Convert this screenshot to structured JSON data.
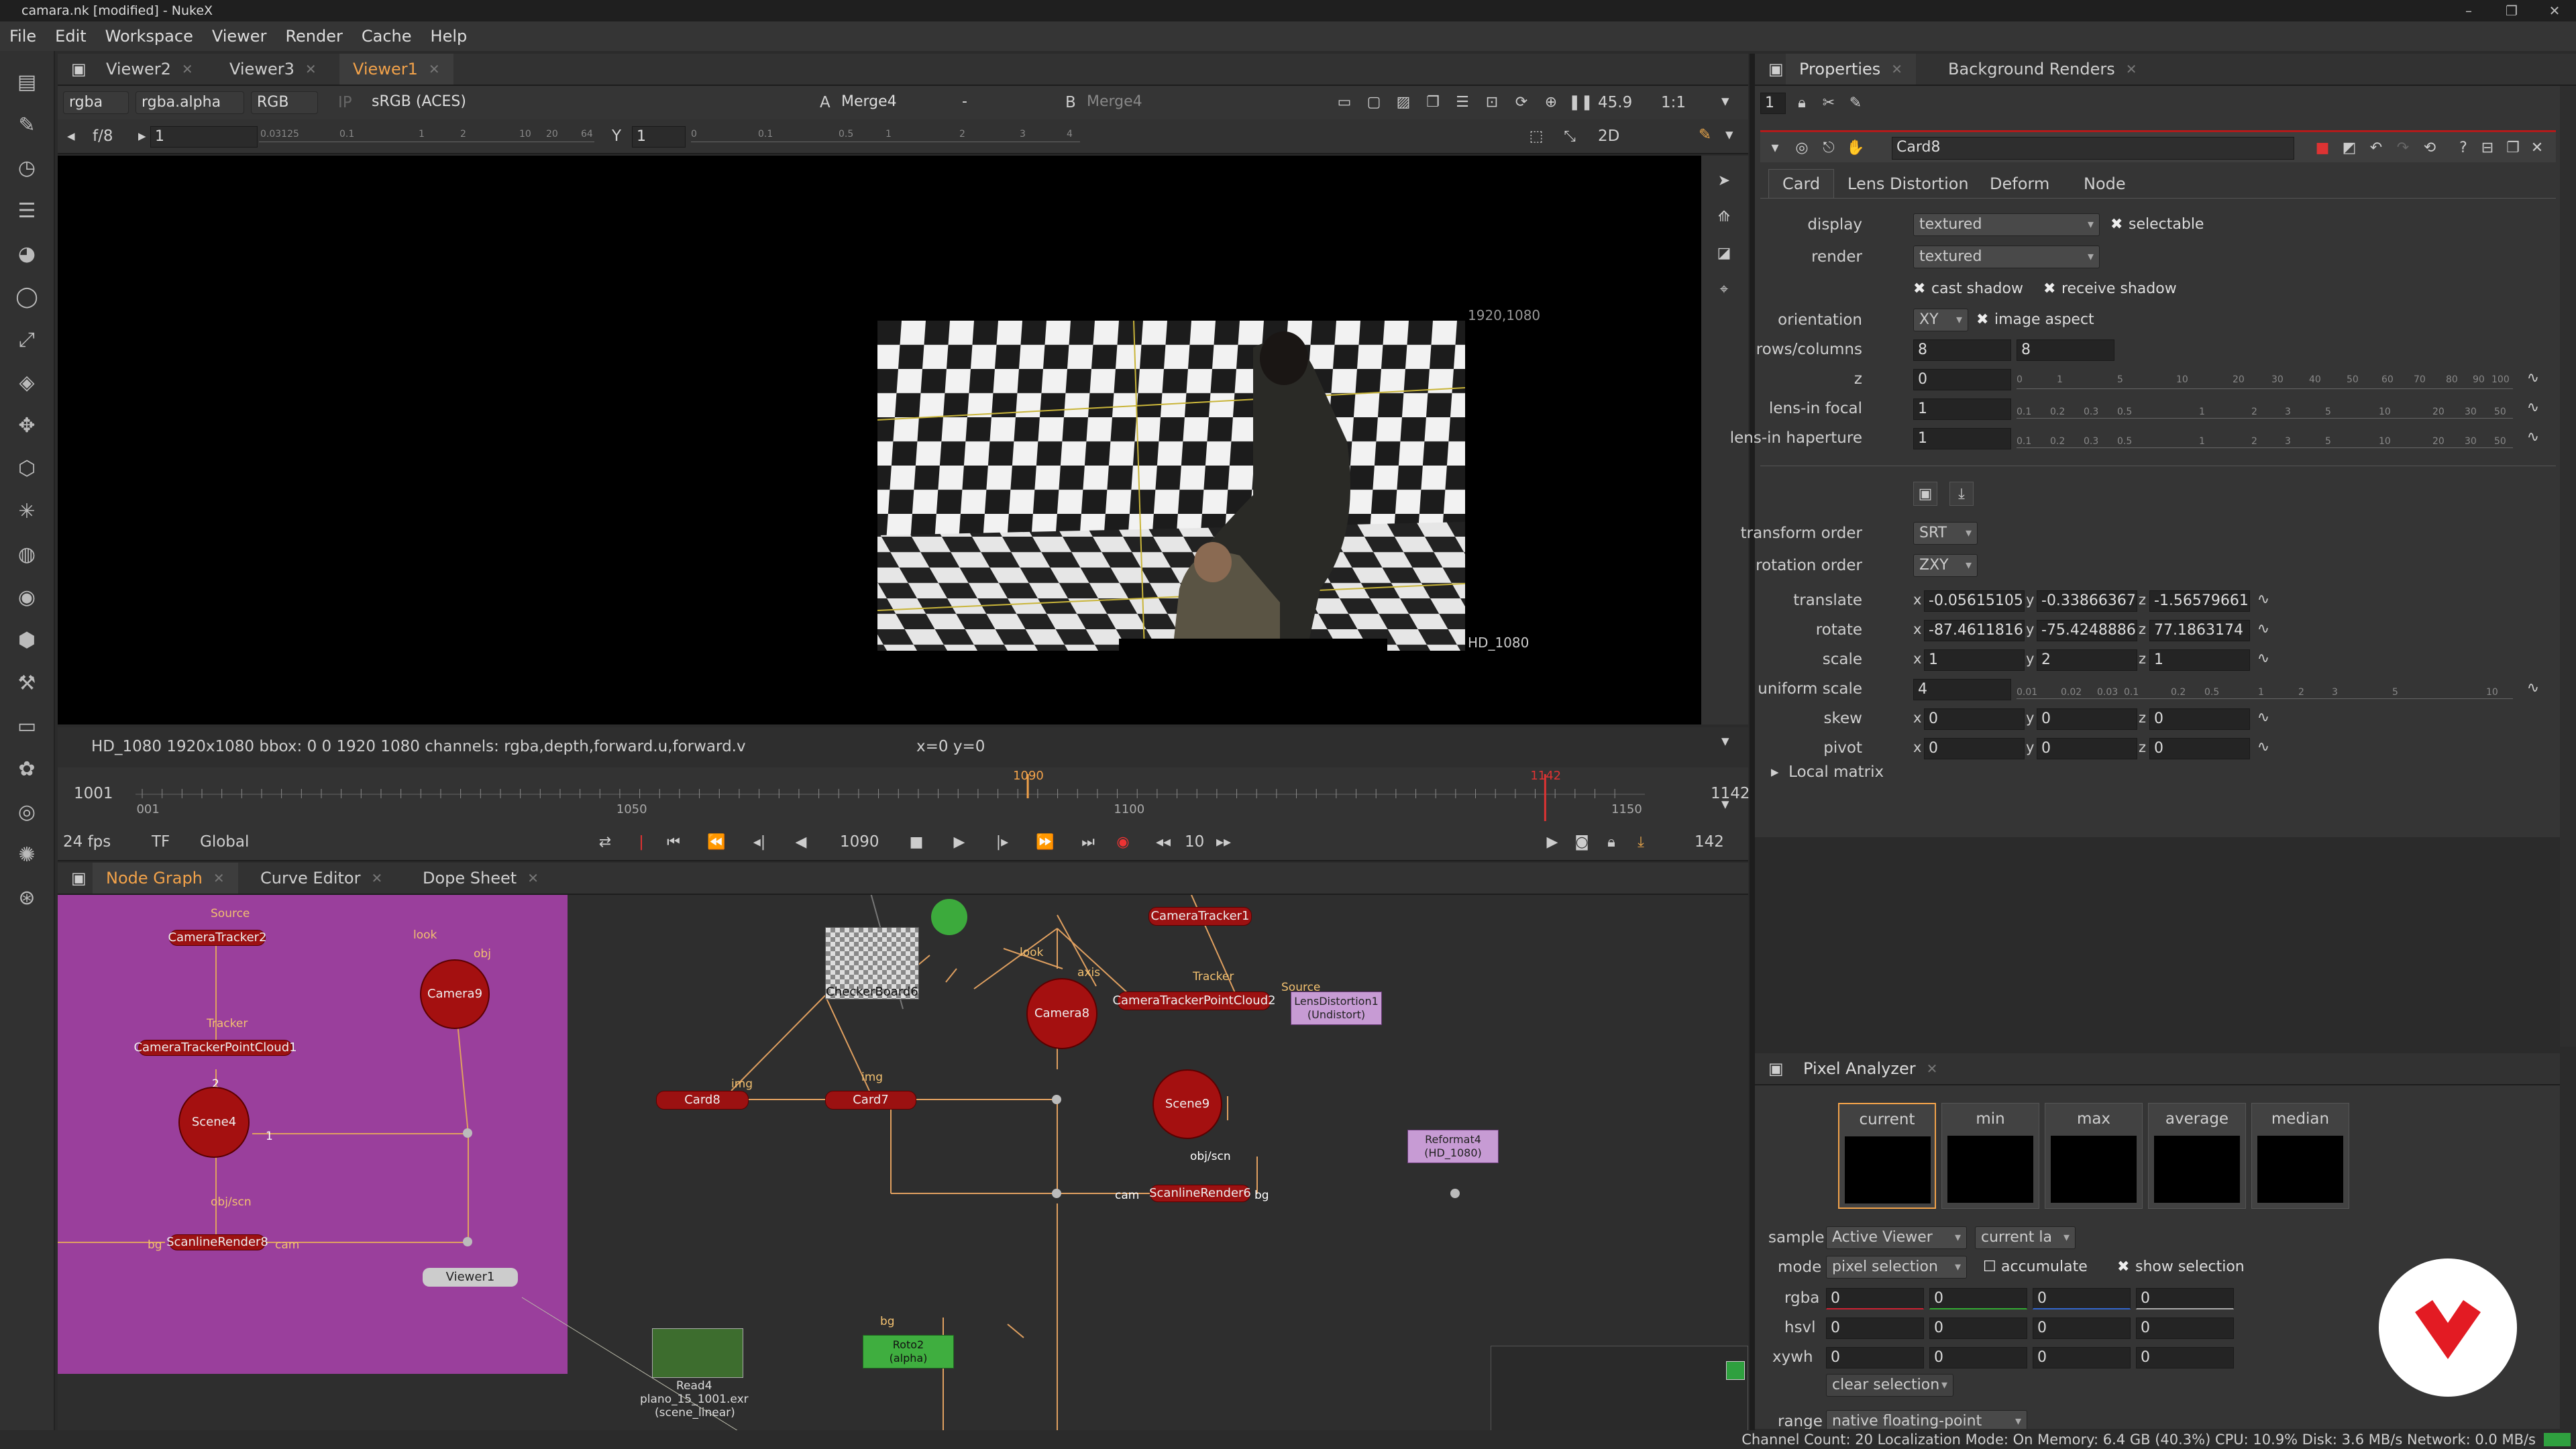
{
  "window": {
    "title": "camara.nk [modified] - NukeX",
    "min": "–",
    "max": "❐",
    "close": "✕"
  },
  "menu": [
    "File",
    "Edit",
    "Workspace",
    "Viewer",
    "Render",
    "Cache",
    "Help"
  ],
  "viewer": {
    "tabs": [
      "Viewer2",
      "Viewer3",
      "Viewer1"
    ],
    "channels": "rgba",
    "alpha": "rgba.alpha",
    "rgb": "RGB",
    "ip": "IP",
    "colorspace": "sRGB (ACES)",
    "a_label": "A",
    "a_input": "Merge4",
    "dash": "-",
    "b_label": "B",
    "b_input": "Merge4",
    "zoom": "45.9",
    "ratio": "1:1",
    "view_mode": "2D",
    "fstop": "f/8",
    "gain": "1",
    "y_label": "Y",
    "gamma": "1",
    "gain_ticks": [
      "0.03125",
      "0.1",
      "1",
      "2",
      "10",
      "20",
      "64"
    ],
    "gamma_ticks": [
      "0",
      "0.1",
      "0.5",
      "1",
      "2",
      "3",
      "4"
    ],
    "format_top": "1920,1080",
    "format_bottom": "HD_1080",
    "info_left": "HD_1080 1920x1080  bbox: 0 0 1920 1080 channels: rgba,depth,forward.u,forward.v",
    "info_coords": "x=0 y=0"
  },
  "timeline": {
    "start": "1001",
    "end": "1142",
    "current": "1090",
    "out_marker": "1142",
    "ticks": [
      "1001",
      "1050",
      "1100",
      "1150"
    ],
    "fps": "24 fps",
    "tf": "TF",
    "scope": "Global",
    "frame": "1090",
    "step": "10",
    "frames": "142"
  },
  "nodegraph": {
    "tabs": [
      "Node Graph",
      "Curve Editor",
      "Dope Sheet"
    ],
    "nodes": {
      "cameratracker2": "CameraTracker2",
      "pointcloud1": "CameraTrackerPointCloud1",
      "scene4": "Scene4",
      "scanline8": "ScanlineRender8",
      "camera9": "Camera9",
      "viewer1": "Viewer1",
      "checker6": "CheckerBoard6",
      "card8": "Card8",
      "card7": "Card7",
      "camera8": "Camera8",
      "cameratracker1": "CameraTracker1",
      "pointcloud2": "CameraTrackerPointCloud2",
      "lensdist": "LensDistortion1",
      "lensdist_sub": "(Undistort)",
      "scene9": "Scene9",
      "scanline6": "ScanlineRender6",
      "reformat4": "Reformat4",
      "reformat4_sub": "(HD_1080)",
      "read4": "Read4",
      "read4_sub": "plano_15_1001.exr",
      "read4_cs": "(scene_linear)",
      "roto2": "Roto2",
      "roto2_sub": "(alpha)"
    },
    "pins": {
      "source": "Source",
      "tracker": "Tracker",
      "look": "look",
      "obj": "obj",
      "img": "img",
      "axis": "axis",
      "objscn": "obj/scn",
      "bg": "bg",
      "cam": "cam",
      "n2": "2",
      "n1": "1"
    }
  },
  "properties": {
    "tabs": [
      "Properties",
      "Background Renders"
    ],
    "panel_count": "1",
    "node_name": "Card8",
    "subtabs": [
      "Card",
      "Lens Distortion",
      "Deform",
      "Node"
    ],
    "display": {
      "label": "display",
      "value": "textured",
      "selectable": "selectable"
    },
    "render": {
      "label": "render",
      "value": "textured"
    },
    "cast_shadow": "cast shadow",
    "receive_shadow": "receive shadow",
    "orientation": {
      "label": "orientation",
      "value": "XY",
      "image_aspect": "image aspect"
    },
    "rows_columns": {
      "label": "rows/columns",
      "rows": "8",
      "cols": "8"
    },
    "z": {
      "label": "z",
      "value": "0"
    },
    "lens_focal": {
      "label": "lens-in focal",
      "value": "1"
    },
    "lens_haperture": {
      "label": "lens-in haperture",
      "value": "1"
    },
    "slider_ticks_z": [
      "0",
      "1",
      "5",
      "10",
      "20",
      "30",
      "40",
      "50",
      "60",
      "70",
      "80",
      "90",
      "100"
    ],
    "slider_ticks_focal": [
      "0.1",
      "0.2",
      "0.3",
      "0.5",
      "1",
      "2",
      "3",
      "5",
      "10",
      "20",
      "30",
      "50"
    ],
    "transform_order": {
      "label": "transform order",
      "value": "SRT"
    },
    "rotation_order": {
      "label": "rotation order",
      "value": "ZXY"
    },
    "translate": {
      "label": "translate",
      "x": "-0.05615105",
      "y": "-0.33866367",
      "z": "-1.56579661"
    },
    "rotate": {
      "label": "rotate",
      "x": "-87.4611816",
      "y": "-75.4248886",
      "z": "77.1863174"
    },
    "scale": {
      "label": "scale",
      "x": "1",
      "y": "2",
      "z": "1"
    },
    "uniform_scale": {
      "label": "uniform scale",
      "value": "4"
    },
    "uscale_ticks": [
      "0.01",
      "0.02",
      "0.03",
      "0.1",
      "0.2",
      "0.5",
      "1",
      "2",
      "3",
      "5",
      "10"
    ],
    "skew": {
      "label": "skew",
      "x": "0",
      "y": "0",
      "z": "0"
    },
    "pivot": {
      "label": "pivot",
      "x": "0",
      "y": "0",
      "z": "0"
    },
    "local_matrix": "Local matrix",
    "axes": {
      "x": "x",
      "y": "y",
      "z": "z"
    }
  },
  "pixel_analyzer": {
    "title": "Pixel Analyzer",
    "swatches": [
      "current",
      "min",
      "max",
      "average",
      "median"
    ],
    "sample": {
      "label": "sample",
      "value": "Active Viewer",
      "value2": "current la"
    },
    "mode": {
      "label": "mode",
      "value": "pixel selection",
      "accumulate": "accumulate",
      "show_selection": "show selection"
    },
    "rows": [
      {
        "label": "rgba",
        "values": [
          "0",
          "0",
          "0",
          "0"
        ]
      },
      {
        "label": "hsvl",
        "values": [
          "0",
          "0",
          "0",
          "0"
        ]
      },
      {
        "label": "xywh",
        "values": [
          "0",
          "0",
          "0",
          "0"
        ]
      }
    ],
    "clear": "clear selection",
    "range_label": "range",
    "range_value": "native floating-point"
  },
  "statusbar": "Channel Count: 20  Localization Mode: On  Memory: 6.4 GB (40.3%)  CPU: 10.9%  Disk: 3.6 MB/s  Network: 0.0 MB/s",
  "colors": {
    "accent": "#f2a24a",
    "node_red": "#9b1111",
    "backdrop": "#9a3f9c",
    "roto": "#3fae3f",
    "reformat": "#c79bd4"
  }
}
